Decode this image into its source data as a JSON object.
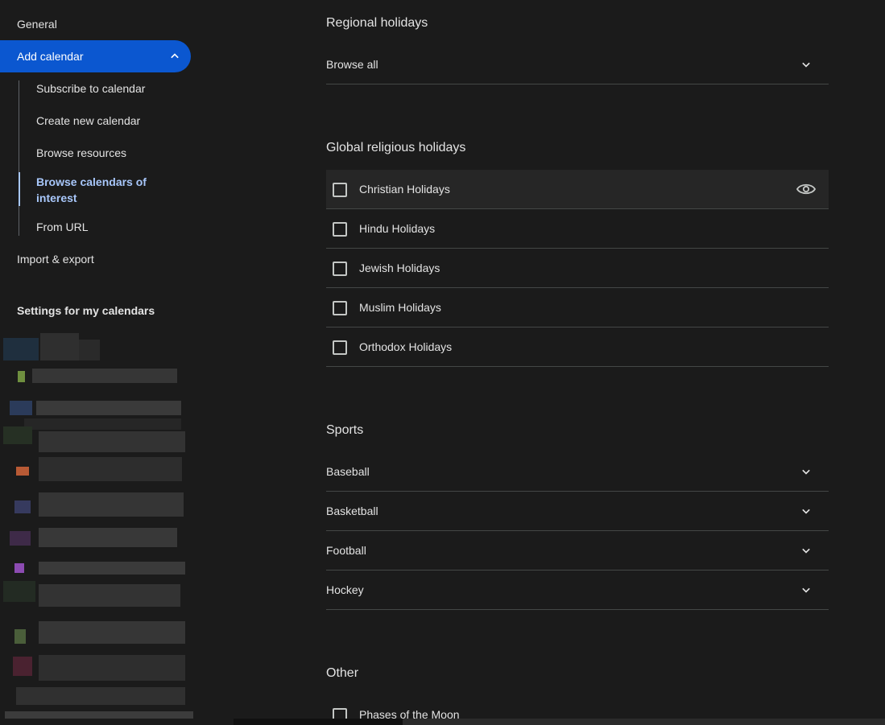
{
  "sidebar": {
    "general": "General",
    "add_calendar": "Add calendar",
    "sub_items": [
      "Subscribe to calendar",
      "Create new calendar",
      "Browse resources",
      "Browse calendars of interest",
      "From URL"
    ],
    "import_export": "Import & export",
    "settings_for_my_calendars": "Settings for my calendars"
  },
  "main": {
    "regional": {
      "heading": "Regional holidays",
      "browse_all": "Browse all"
    },
    "religious": {
      "heading": "Global religious holidays",
      "items": [
        "Christian Holidays",
        "Hindu Holidays",
        "Jewish Holidays",
        "Muslim Holidays",
        "Orthodox Holidays"
      ]
    },
    "sports": {
      "heading": "Sports",
      "items": [
        "Baseball",
        "Basketball",
        "Football",
        "Hockey"
      ]
    },
    "other": {
      "heading": "Other",
      "items": [
        "Phases of the Moon"
      ]
    }
  },
  "icons": {
    "chevron": "chevron-down-icon",
    "eye": "eye-icon",
    "collapse": "chevron-up-icon"
  },
  "colors": {
    "accent": "#0b57d0",
    "active_text": "#a8c7fa",
    "background": "#1b1b1b"
  }
}
